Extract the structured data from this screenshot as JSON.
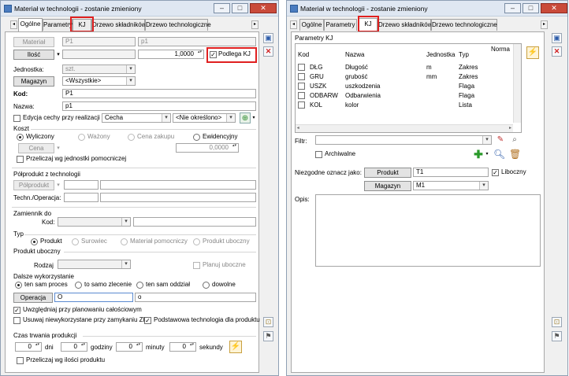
{
  "left": {
    "title": "Materiał w technologii - zostanie zmieniony",
    "tabs": [
      "Ogólne",
      "Parametry",
      "KJ",
      "Drzewo składników",
      "Drzewo technologiczne"
    ],
    "material_btn": "Materiał",
    "material_code": "P1",
    "material_name": "p1",
    "ilosc_btn": "Ilość",
    "ilosc_value": "1,0000",
    "podlega_kj": "Podlega KJ",
    "jednostka_label": "Jednostka:",
    "jednostka_value": "szt.",
    "magazyn_btn": "Magazyn",
    "magazyn_value": "<Wszystkie>",
    "kod_label": "Kod:",
    "kod_value": "P1",
    "nazwa_label": "Nazwa:",
    "nazwa_value": "p1",
    "edycja_cechy": "Edycja cechy przy realizacji",
    "cecha_value": "Cecha",
    "nieokreslono_value": "<Nie określono>",
    "koszt_label": "Koszt",
    "koszt_options": [
      "Wyliczony",
      "Ważony",
      "Cena zakupu",
      "Ewidencyjny"
    ],
    "cena_btn": "Cena",
    "cena_value": "0,0000",
    "przeliczaj_jedn": "Przeliczaj wg jednostki pomocniczej",
    "polprodukt_label": "Półprodukt z technologii",
    "polprodukt_btn": "Półprodukt",
    "techn_label": "Techn./Operacja:",
    "zamiennik_label": "Zamiennik do",
    "zamiennik_kod_label": "Kod:",
    "typ_label": "Typ",
    "typ_options": [
      "Produkt",
      "Surowiec",
      "Materiał pomocniczy",
      "Produkt uboczny"
    ],
    "produkt_uboczny_label": "Produkt uboczny",
    "rodzaj_label": "Rodzaj",
    "planuj_uboczne": "Planuj uboczne",
    "dalsze_label": "Dalsze wykorzystanie",
    "dalsze_options": [
      "ten sam proces",
      "to samo zlecenie",
      "ten sam oddział",
      "dowolne"
    ],
    "operacja_btn": "Operacja",
    "operacja_code": "O",
    "operacja_name": "o",
    "uwzgledniaj": "Uwzględniaj przy planowaniu całościowym",
    "usuwaj": "Usuwaj niewykorzystane przy zamykaniu ZP",
    "podstawowa": "Podstawowa technologia dla produktu",
    "czas_label": "Czas trwania produkcji",
    "czas_values": [
      "0",
      "0",
      "0",
      "0"
    ],
    "czas_units": [
      "dni",
      "godziny",
      "minuty",
      "sekundy"
    ],
    "przeliczaj_ilosci": "Przeliczaj wg ilości produktu"
  },
  "right": {
    "title": "Materiał w technologii - zostanie zmieniony",
    "tabs": [
      "Ogólne",
      "Parametry",
      "KJ",
      "Drzewo składników",
      "Drzewo technologiczne"
    ],
    "group_label": "Parametry KJ",
    "columns": [
      "Kod",
      "Nazwa",
      "Jednostka",
      "Typ",
      "Norma"
    ],
    "rows": [
      {
        "kod": "DŁG",
        "nazwa": "Długość",
        "jednostka": "m",
        "typ": "Zakres"
      },
      {
        "kod": "GRU",
        "nazwa": "grubość",
        "jednostka": "mm",
        "typ": "Zakres"
      },
      {
        "kod": "USZK",
        "nazwa": "uszkodzenia",
        "jednostka": "",
        "typ": "Flaga"
      },
      {
        "kod": "ODBARW",
        "nazwa": "Odbarwienia",
        "jednostka": "",
        "typ": "Flaga"
      },
      {
        "kod": "KOL",
        "nazwa": "kolor",
        "jednostka": "",
        "typ": "Lista"
      }
    ],
    "filtr_label": "Filtr:",
    "archiwalne": "Archiwalne",
    "niezgodne_label": "Niezgodne oznacz jako:",
    "produkt_btn": "Produkt",
    "produkt_value": "T1",
    "liboczny": "Liboczny",
    "magazyn_btn": "Magazyn",
    "magazyn_value": "M1",
    "opis_label": "Opis:"
  },
  "colors": {
    "highlight": "#e02020",
    "titlebar": "#dfe7f2",
    "close": "#c94a3a"
  }
}
